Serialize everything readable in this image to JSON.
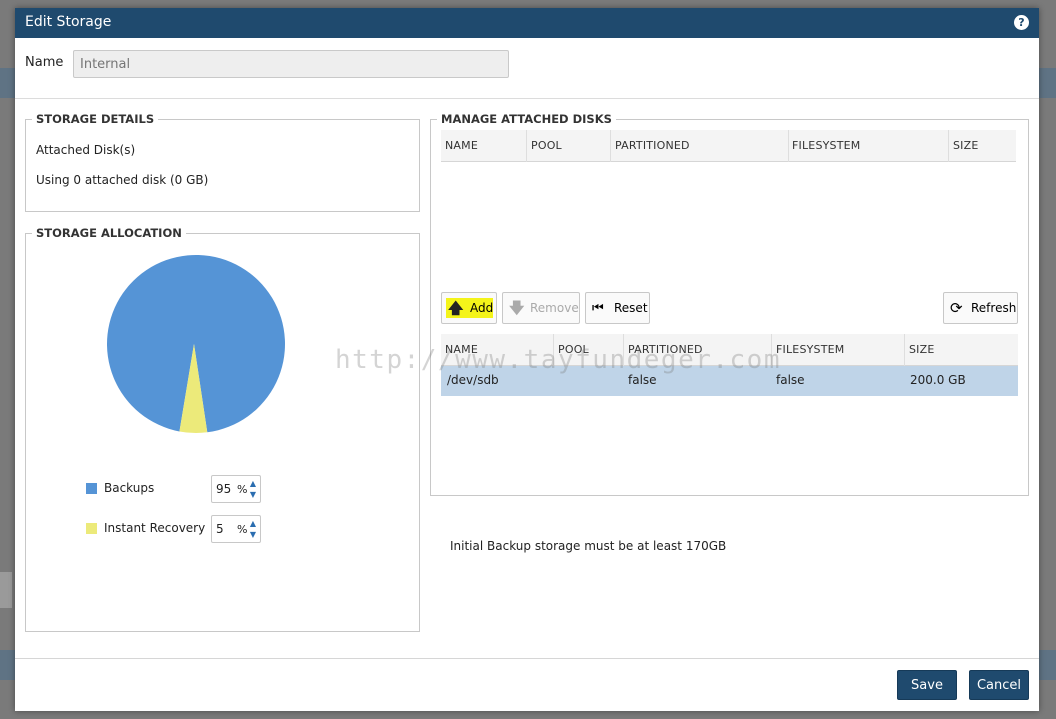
{
  "dialog": {
    "title": "Edit Storage",
    "name_label": "Name",
    "name_placeholder": "Internal"
  },
  "storage_details": {
    "legend": "STORAGE DETAILS",
    "attached_label": "Attached Disk(s)",
    "using_text": "Using 0 attached disk (0 GB)"
  },
  "storage_allocation": {
    "legend": "STORAGE ALLOCATION",
    "items": [
      {
        "label": "Backups",
        "value": "95",
        "unit": "%",
        "color": "#5594d6",
        "percent": 95
      },
      {
        "label": "Instant Recovery",
        "value": "5",
        "unit": "%",
        "color": "#ecea7a",
        "percent": 5
      }
    ]
  },
  "manage_disks": {
    "legend": "MANAGE ATTACHED DISKS",
    "top_columns": [
      "NAME",
      "POOL",
      "PARTITIONED",
      "FILESYSTEM",
      "SIZE"
    ],
    "buttons": {
      "add": "Add",
      "remove": "Remove",
      "reset": "Reset",
      "refresh": "Refresh"
    },
    "bottom_columns": [
      "NAME",
      "POOL",
      "PARTITIONED",
      "FILESYSTEM",
      "SIZE"
    ],
    "rows": [
      {
        "name": "/dev/sdb",
        "pool": "",
        "partitioned": "false",
        "filesystem": "false",
        "size": "200.0 GB"
      }
    ]
  },
  "notice": "Initial Backup storage must be at least 170GB",
  "watermark": "http://www.tayfundeger.com",
  "footer": {
    "save": "Save",
    "cancel": "Cancel"
  },
  "colors": {
    "titlebar": "#1f4a6e",
    "selected_row": "#bfd4e8",
    "add_highlight": "#f4f41a"
  }
}
